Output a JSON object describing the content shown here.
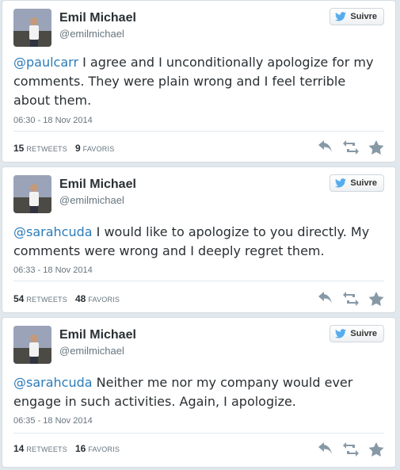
{
  "colors": {
    "link": "#2b7bb9",
    "bird": "#55acee",
    "text": "#292f33",
    "muted": "#66757f"
  },
  "tweets": [
    {
      "name": "Emil Michael",
      "handle": "@emilmichael",
      "follow_label": "Suivre",
      "mention": "@paulcarr",
      "text": " I agree and I unconditionally apologize for my comments.  They were plain wrong and I feel terrible about them.",
      "date": "06:30 - 18 Nov 2014",
      "retweets_count": "15",
      "retweets_label": "RETWEETS",
      "favorites_count": "9",
      "favorites_label": "FAVORIS",
      "icons": [
        "reply-icon",
        "retweet-icon",
        "favorite-icon"
      ]
    },
    {
      "name": "Emil Michael",
      "handle": "@emilmichael",
      "follow_label": "Suivre",
      "mention": "@sarahcuda",
      "text": " I would like to apologize to you directly.  My comments were wrong and I deeply regret them.",
      "date": "06:33 - 18 Nov 2014",
      "retweets_count": "54",
      "retweets_label": "RETWEETS",
      "favorites_count": "48",
      "favorites_label": "FAVORIS",
      "icons": [
        "reply-icon",
        "retweet-icon",
        "favorite-icon"
      ]
    },
    {
      "name": "Emil Michael",
      "handle": "@emilmichael",
      "follow_label": "Suivre",
      "mention": "@sarahcuda",
      "text": " Neither me nor my company would ever engage in such activities. Again, I apologize.",
      "date": "06:35 - 18 Nov 2014",
      "retweets_count": "14",
      "retweets_label": "RETWEETS",
      "favorites_count": "16",
      "favorites_label": "FAVORIS",
      "icons": [
        "reply-icon",
        "retweet-icon",
        "favorite-icon"
      ]
    }
  ]
}
